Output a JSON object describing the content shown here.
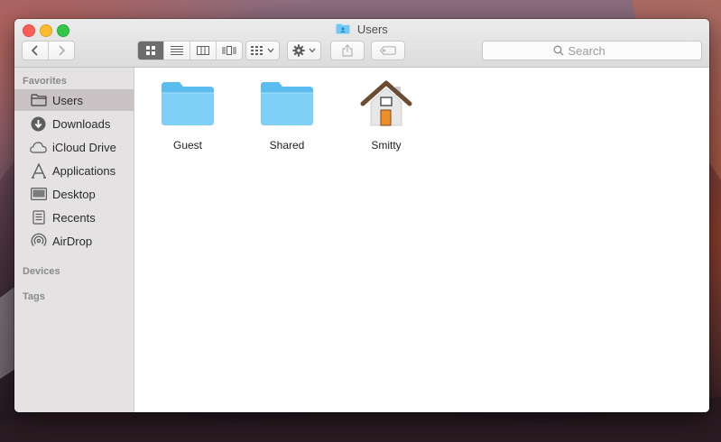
{
  "window": {
    "title": "Users"
  },
  "toolbar": {
    "back_icon": "chevron-left-icon",
    "forward_icon": "chevron-right-icon",
    "views": [
      "icon-view-icon",
      "list-view-icon",
      "column-view-icon",
      "cover-flow-icon"
    ],
    "active_view": "icon-view-icon",
    "arrange_icon": "arrange-grid-icon",
    "action_icon": "gear-icon",
    "share_icon": "share-icon",
    "tag_icon": "tag-icon"
  },
  "search": {
    "placeholder": "Search"
  },
  "sidebar": {
    "favorites_heading": "Favorites",
    "items": [
      {
        "label": "Users",
        "icon": "folder-icon",
        "selected": true
      },
      {
        "label": "Downloads",
        "icon": "download-icon",
        "selected": false
      },
      {
        "label": "iCloud Drive",
        "icon": "cloud-icon",
        "selected": false
      },
      {
        "label": "Applications",
        "icon": "applications-icon",
        "selected": false
      },
      {
        "label": "Desktop",
        "icon": "desktop-icon",
        "selected": false
      },
      {
        "label": "Recents",
        "icon": "recents-icon",
        "selected": false
      },
      {
        "label": "AirDrop",
        "icon": "airdrop-icon",
        "selected": false
      }
    ],
    "devices_heading": "Devices",
    "tags_heading": "Tags"
  },
  "files": [
    {
      "name": "Guest",
      "icon": "folder-icon"
    },
    {
      "name": "Shared",
      "icon": "folder-icon"
    },
    {
      "name": "Smitty",
      "icon": "home-icon"
    }
  ],
  "colors": {
    "folder_blue": "#6fc8f5",
    "selection": "#c9c3c6",
    "close": "#fc5f57",
    "minimize": "#fdbc2e",
    "maximize": "#33c748"
  }
}
